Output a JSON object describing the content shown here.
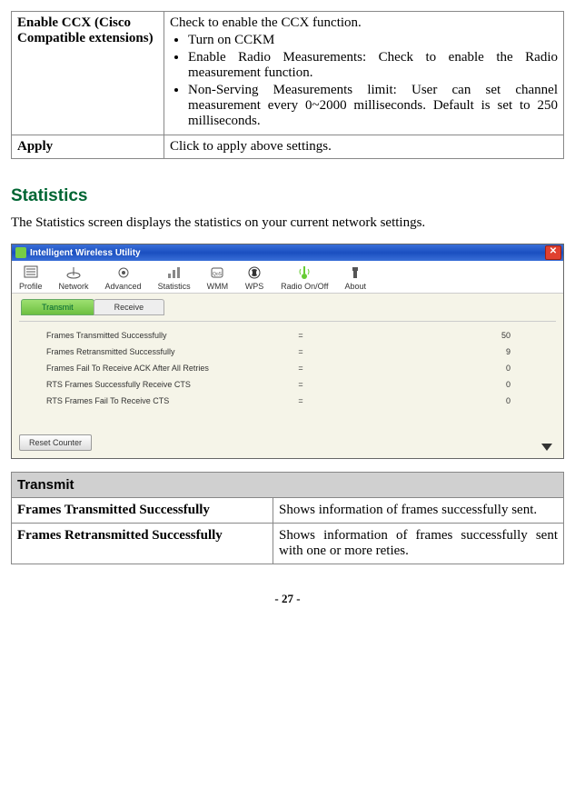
{
  "table1": {
    "row1": {
      "label": "Enable CCX (Cisco Compatible extensions)",
      "intro": "Check to enable the CCX function.",
      "bullet1": "Turn on CCKM",
      "bullet2": "Enable Radio Measurements: Check to enable the Radio measurement function.",
      "bullet3": "Non-Serving Measurements limit: User can set channel measurement every 0~2000 milliseconds. Default is set to 250 milliseconds."
    },
    "row2": {
      "label": "Apply",
      "desc": "Click to apply above settings."
    }
  },
  "section_title": "Statistics",
  "intro_text": "The Statistics screen displays the statistics on your current network settings.",
  "screenshot": {
    "title": "Intelligent Wireless Utility",
    "toolbar": {
      "profile": "Profile",
      "network": "Network",
      "advanced": "Advanced",
      "statistics": "Statistics",
      "wmm": "WMM",
      "wps": "WPS",
      "radio": "Radio On/Off",
      "about": "About"
    },
    "subtabs": {
      "transmit": "Transmit",
      "receive": "Receive"
    },
    "stats": [
      {
        "label": "Frames Transmitted Successfully",
        "value": "50"
      },
      {
        "label": "Frames Retransmitted Successfully",
        "value": "9"
      },
      {
        "label": "Frames Fail To Receive ACK After All Retries",
        "value": "0"
      },
      {
        "label": "RTS Frames Successfully Receive CTS",
        "value": "0"
      },
      {
        "label": "RTS Frames Fail To Receive CTS",
        "value": "0"
      }
    ],
    "reset_button": "Reset Counter"
  },
  "table2": {
    "header": "Transmit",
    "row1": {
      "label": "Frames Transmitted Successfully",
      "desc": "Shows information of frames successfully sent."
    },
    "row2": {
      "label": "Frames Retransmitted Successfully",
      "desc": "Shows information of frames successfully sent with one or more reties."
    }
  },
  "page_number": "- 27 -"
}
